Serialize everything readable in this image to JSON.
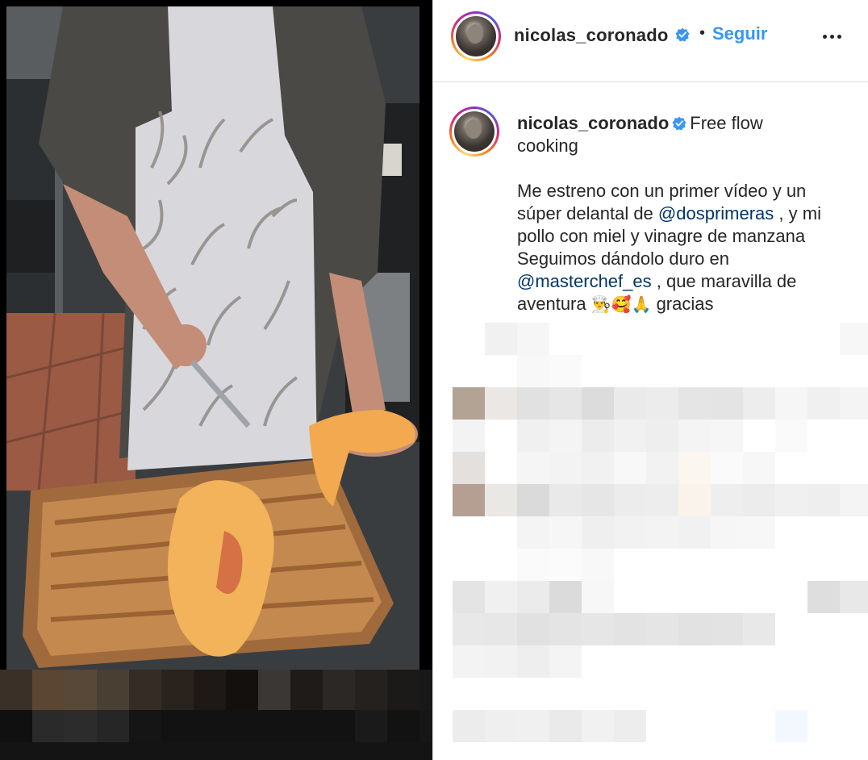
{
  "post": {
    "username": "nicolas_coronado",
    "follow_label": "Seguir",
    "separator": "•",
    "caption": {
      "username": "nicolas_coronado",
      "title_line1": "Free flow",
      "title_line2": "cooking",
      "p1_line1": "Me estreno con un primer vídeo y un",
      "p1_line2_pre": "súper delantal de ",
      "mention1": "@dosprimeras",
      "p1_line2_post": " , y mi",
      "p1_line3": "pollo con miel y vinagre de manzana",
      "p1_line4": "Seguimos dándolo duro en",
      "mention2": "@masterchef_es",
      "p1_line5_post": " , que maravilla de",
      "p1_line6_pre": "aventura ",
      "emojis": "👨‍🍳🥰🙏",
      "p1_line6_post": " gracias"
    }
  },
  "icons": {
    "verified": "verified-badge-icon",
    "more": "more-options-icon",
    "avatar": "profile-avatar"
  },
  "colors": {
    "accent_blue": "#3797f0",
    "link_blue": "#00376b",
    "text": "#262626",
    "border": "#dbdbdb"
  }
}
